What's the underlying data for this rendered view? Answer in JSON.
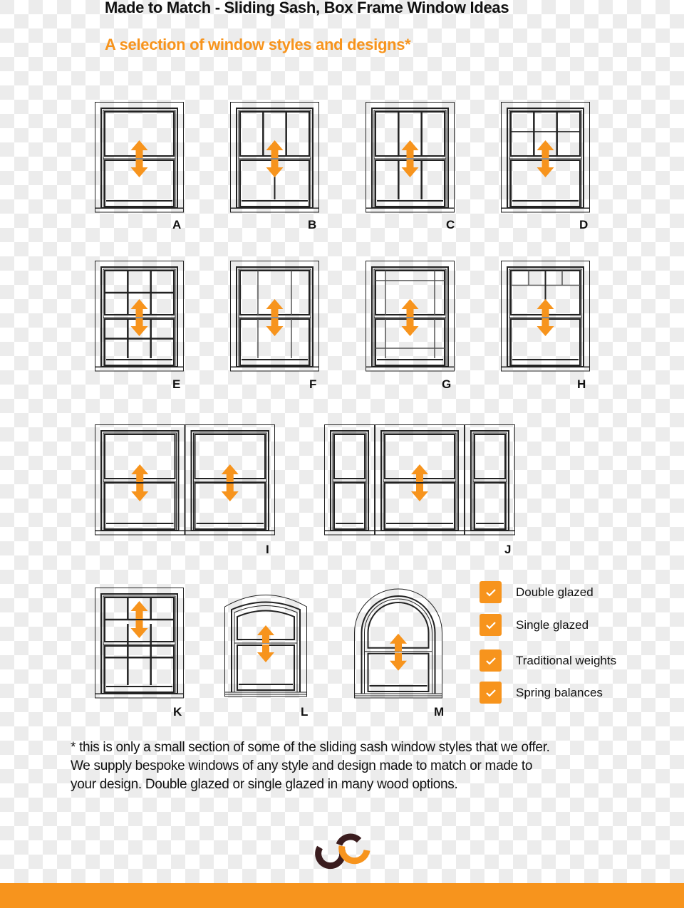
{
  "header": {
    "title": "Made to Match - Sliding Sash, Box Frame Window Ideas",
    "subtitle": "A selection of window styles and designs*"
  },
  "colors": {
    "accent": "#f7941d",
    "line": "#222222",
    "text": "#111111",
    "logo_dark": "#3a1c1e"
  },
  "windows": [
    {
      "id": "A",
      "label": "A",
      "style": "plain"
    },
    {
      "id": "B",
      "label": "B",
      "style": "three-over-two"
    },
    {
      "id": "C",
      "label": "C",
      "style": "three-over-three"
    },
    {
      "id": "D",
      "label": "D",
      "style": "six-light-top-over-plain"
    },
    {
      "id": "E",
      "label": "E",
      "style": "six-over-six"
    },
    {
      "id": "F",
      "label": "F",
      "style": "margin-bars-vertical"
    },
    {
      "id": "G",
      "label": "G",
      "style": "margin-bars-both"
    },
    {
      "id": "H",
      "label": "H",
      "style": "top-lights"
    },
    {
      "id": "I",
      "label": "I",
      "style": "pair-plain"
    },
    {
      "id": "J",
      "label": "J",
      "style": "tripartite"
    },
    {
      "id": "K",
      "label": "K",
      "style": "three-over-six"
    },
    {
      "id": "L",
      "label": "L",
      "style": "segmental-arch"
    },
    {
      "id": "M",
      "label": "M",
      "style": "round-arch"
    }
  ],
  "icons": {
    "slide_arrow": "up-down-arrow-icon",
    "check": "check-icon"
  },
  "features": [
    {
      "label": "Double glazed",
      "checked": true
    },
    {
      "label": "Single glazed",
      "checked": true
    },
    {
      "label": "Traditional weights",
      "checked": true
    },
    {
      "label": "Spring balances",
      "checked": true
    }
  ],
  "footnote": {
    "lines": [
      "* this is only a small section of some of the sliding sash window styles that we offer.",
      "We supply bespoke windows of any style and design made to match or made to",
      "your design. Double glazed or single glazed in many wood options."
    ]
  },
  "footer": {
    "logo": "company-logo"
  }
}
